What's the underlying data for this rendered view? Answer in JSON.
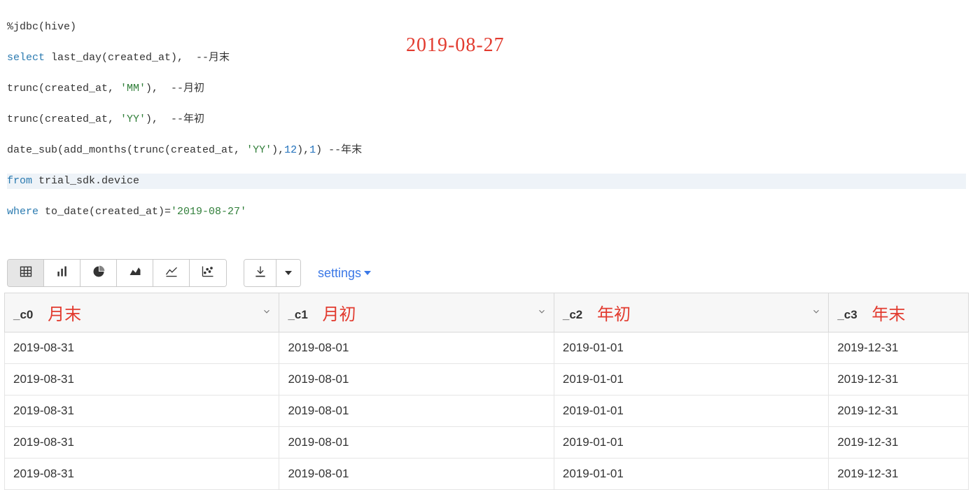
{
  "code": {
    "interp": "%jdbc(hive)",
    "select_kw": "select",
    "from_kw": "from",
    "where_kw": "where",
    "l1_rest": " last_day(created_at),  --月末",
    "l2": "trunc(created_at, ",
    "l2_str": "'MM'",
    "l2_rest": "),  --月初",
    "l3": "trunc(created_at, ",
    "l3_str": "'YY'",
    "l3_rest": "),  --年初",
    "l4a": "date_sub(add_months(trunc(created_at, ",
    "l4_str": "'YY'",
    "l4b": "),",
    "l4_num": "12",
    "l4c": "),",
    "l4_num2": "1",
    "l4d": ") --年末",
    "from_rest": " trial_sdk.device",
    "where_rest_a": " to_date(created_at)=",
    "where_str": "'2019-08-27'"
  },
  "title_date": "2019-08-27",
  "toolbar": {
    "settings_label": "settings"
  },
  "table": {
    "columns": [
      {
        "key": "c0",
        "header": "_c0",
        "anno": "月末"
      },
      {
        "key": "c1",
        "header": "_c1",
        "anno": "月初"
      },
      {
        "key": "c2",
        "header": "_c2",
        "anno": "年初"
      },
      {
        "key": "c3",
        "header": "_c3",
        "anno": "年末"
      }
    ],
    "rows": [
      {
        "c0": "2019-08-31",
        "c1": "2019-08-01",
        "c2": "2019-01-01",
        "c3": "2019-12-31"
      },
      {
        "c0": "2019-08-31",
        "c1": "2019-08-01",
        "c2": "2019-01-01",
        "c3": "2019-12-31"
      },
      {
        "c0": "2019-08-31",
        "c1": "2019-08-01",
        "c2": "2019-01-01",
        "c3": "2019-12-31"
      },
      {
        "c0": "2019-08-31",
        "c1": "2019-08-01",
        "c2": "2019-01-01",
        "c3": "2019-12-31"
      },
      {
        "c0": "2019-08-31",
        "c1": "2019-08-01",
        "c2": "2019-01-01",
        "c3": "2019-12-31"
      }
    ]
  }
}
